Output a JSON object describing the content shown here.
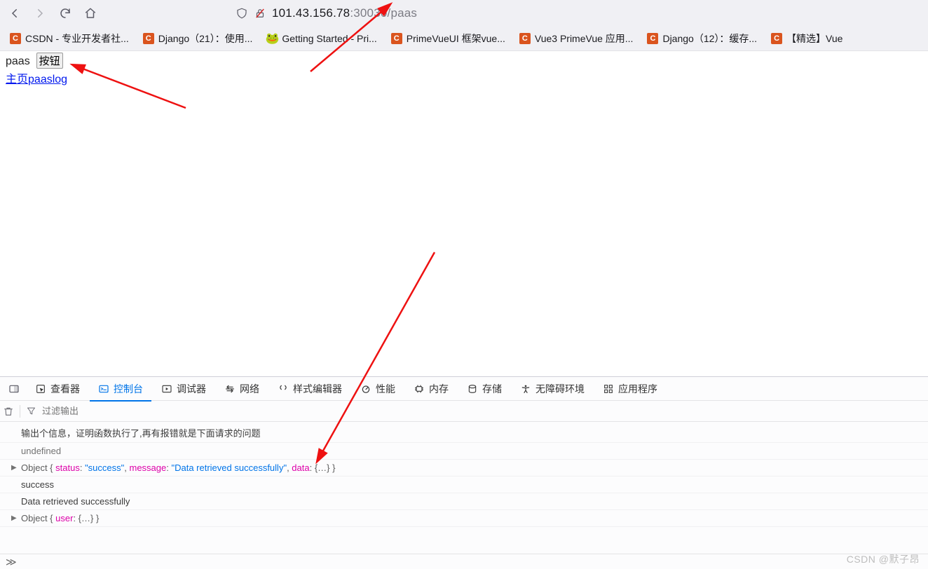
{
  "url": {
    "host": "101.43.156.78",
    "portpath": ":30030/paas"
  },
  "bookmarks": [
    {
      "icon": "C",
      "label": "CSDN - 专业开发者社..."
    },
    {
      "icon": "C",
      "label": "Django（21）：使用..."
    },
    {
      "icon": "🐸",
      "green": true,
      "label": "Getting Started - Pri..."
    },
    {
      "icon": "C",
      "label": "PrimeVueUI 框架vue..."
    },
    {
      "icon": "C",
      "label": "Vue3 PrimeVue 应用..."
    },
    {
      "icon": "C",
      "label": "Django（12）：缓存..."
    },
    {
      "icon": "C",
      "label": "【精选】Vue"
    }
  ],
  "page": {
    "text1": "paas",
    "button": "按钮",
    "link1": "主页",
    "link1b": "paaslog"
  },
  "devtools": {
    "tabs": {
      "inspector": "查看器",
      "console": "控制台",
      "debugger": "调试器",
      "network": "网络",
      "style": "样式编辑器",
      "performance": "性能",
      "memory": "内存",
      "storage": "存储",
      "accessibility": "无障碍环境",
      "apps": "应用程序"
    },
    "filter_placeholder": "过滤输出",
    "rows": {
      "r1": "输出个信息，证明函数执行了,再有报错就是下面请求的问题",
      "r2": "undefined",
      "r3": {
        "prefix": "Object { ",
        "status_k": "status",
        "status_v": "\"success\"",
        "msg_k": "message",
        "msg_v": "\"Data retrieved successfully\"",
        "data_k": "data",
        "data_v": "{…}",
        "suffix": " }"
      },
      "r4": "success",
      "r5": "Data retrieved successfully",
      "r6": {
        "prefix": "Object { ",
        "user_k": "user",
        "user_v": "{…}",
        "suffix": " }"
      }
    },
    "prompt": "≫"
  },
  "watermark": "CSDN @默子昂"
}
